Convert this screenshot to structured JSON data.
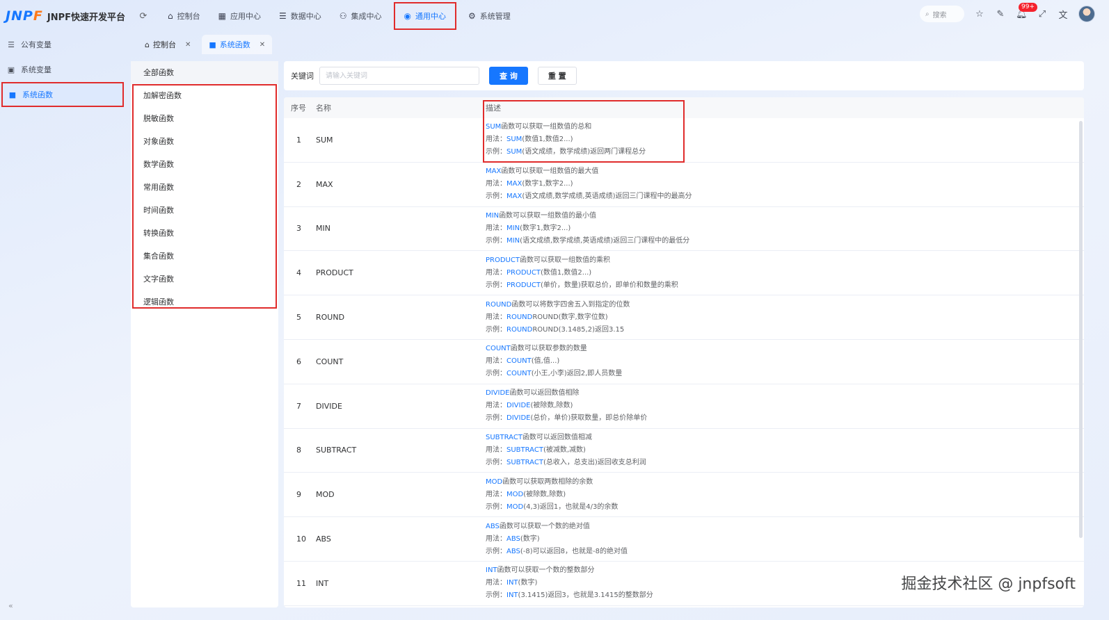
{
  "app": {
    "logo_mark": "JNPF",
    "title": "JNPF快速开发平台"
  },
  "nav": [
    {
      "label": "控制台",
      "icon": "home-icon"
    },
    {
      "label": "应用中心",
      "icon": "app-grid-icon"
    },
    {
      "label": "数据中心",
      "icon": "database-icon"
    },
    {
      "label": "集成中心",
      "icon": "integration-icon"
    },
    {
      "label": "通用中心",
      "icon": "common-center-icon",
      "active": true
    },
    {
      "label": "系统管理",
      "icon": "gear-icon"
    }
  ],
  "topright": {
    "search_label": "搜索",
    "notification_badge": "99+"
  },
  "sidebar": {
    "items": [
      {
        "label": "公有变量",
        "icon": "list-icon"
      },
      {
        "label": "系统变量",
        "icon": "calendar-icon"
      },
      {
        "label": "系统函数",
        "icon": "function-icon",
        "active": true
      }
    ]
  },
  "tabs": [
    {
      "label": "控制台",
      "icon": "home-icon"
    },
    {
      "label": "系统函数",
      "icon": "function-icon",
      "active": true
    }
  ],
  "categories": [
    "全部函数",
    "加解密函数",
    "脱敏函数",
    "对象函数",
    "数学函数",
    "常用函数",
    "时间函数",
    "转换函数",
    "集合函数",
    "文字函数",
    "逻辑函数"
  ],
  "filter": {
    "label": "关键词",
    "placeholder": "请输入关键词",
    "query_label": "查 询",
    "reset_label": "重 置"
  },
  "table": {
    "headers": {
      "no": "序号",
      "name": "名称",
      "desc": "描述"
    },
    "usage_prefix": "用法：",
    "example_prefix": "示例：",
    "rows": [
      {
        "no": "1",
        "name": "SUM",
        "d1": "函数可以获取一组数值的总和",
        "d2": "(数值1,数值2...)",
        "d3": "(语文成绩，数学成绩)返回两门课程总分"
      },
      {
        "no": "2",
        "name": "MAX",
        "d1": "函数可以获取一组数值的最大值",
        "d2": "(数字1,数字2...)",
        "d3": "(语文成绩,数学成绩,英语成绩)返回三门课程中的最高分"
      },
      {
        "no": "3",
        "name": "MIN",
        "d1": "函数可以获取一组数值的最小值",
        "d2": "(数字1,数字2...)",
        "d3": "(语文成绩,数学成绩,英语成绩)返回三门课程中的最低分"
      },
      {
        "no": "4",
        "name": "PRODUCT",
        "d1": "函数可以获取一组数值的乘积",
        "d2": "(数值1,数值2...)",
        "d3": "(单价，数量)获取总价，即单价和数量的乘积"
      },
      {
        "no": "5",
        "name": "ROUND",
        "d1": "函数可以将数字四舍五入到指定的位数",
        "d2": "ROUND(数字,数字位数)",
        "d3": "ROUND(3.1485,2)返回3.15"
      },
      {
        "no": "6",
        "name": "COUNT",
        "d1": "函数可以获取参数的数量",
        "d2": "(值,值...)",
        "d3": "(小王,小李)返回2,即人员数量"
      },
      {
        "no": "7",
        "name": "DIVIDE",
        "d1": "函数可以返回数值相除",
        "d2": "(被除数,除数)",
        "d3": "(总价，单价)获取数量，即总价除单价"
      },
      {
        "no": "8",
        "name": "SUBTRACT",
        "d1": "函数可以返回数值相减",
        "d2": "(被减数,减数)",
        "d3": "(总收入，总支出)返回收支总利润"
      },
      {
        "no": "9",
        "name": "MOD",
        "d1": "函数可以获取两数相除的余数",
        "d2": "(被除数,除数)",
        "d3": "(4,3)返回1，也就是4/3的余数"
      },
      {
        "no": "10",
        "name": "ABS",
        "d1": "函数可以获取一个数的绝对值",
        "d2": "(数字)",
        "d3": "(-8)可以返回8，也就是-8的绝对值"
      },
      {
        "no": "11",
        "name": "INT",
        "d1": "函数可以获取一个数的整数部分",
        "d2": "(数字)",
        "d3": "(3.1415)返回3，也就是3.1415的整数部分"
      }
    ]
  },
  "watermark": "掘金技术社区 @ jnpfsoft",
  "colors": {
    "primary": "#1677ff",
    "highlight_border": "#e02b2b",
    "logo_accent": "#ff7a1a"
  }
}
